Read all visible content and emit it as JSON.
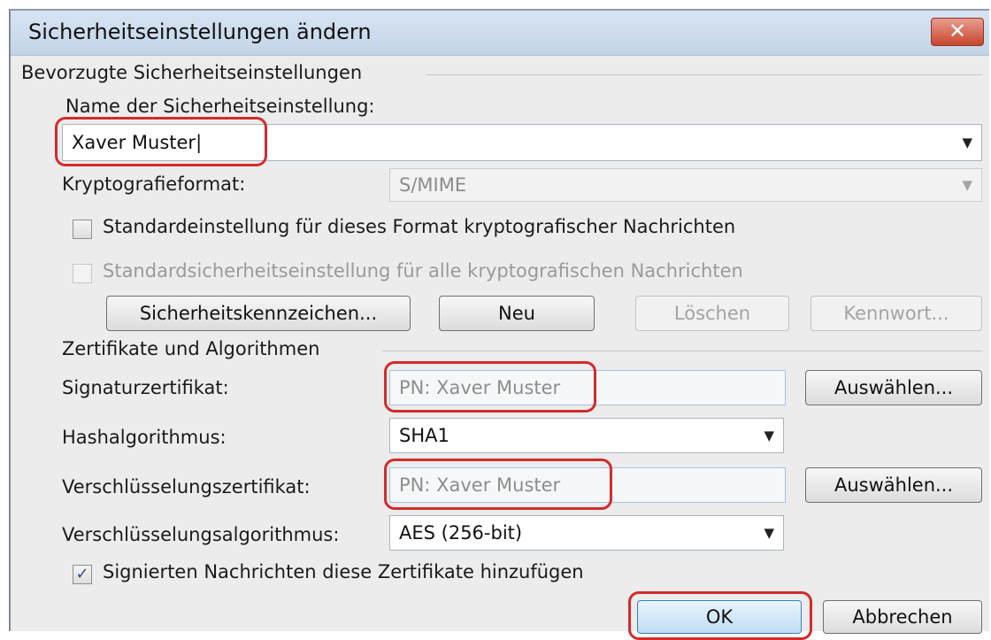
{
  "window": {
    "title": "Sicherheitseinstellungen ändern",
    "close_symbol": "✕"
  },
  "preferred": {
    "group_label": "Bevorzugte Sicherheitseinstellungen",
    "name_label": "Name der Sicherheitseinstellung:",
    "name_value": "Xaver Muster|",
    "crypto_label": "Kryptografieformat:",
    "crypto_value": "S/MIME",
    "chk_default_format_label": "Standardeinstellung für dieses Format kryptografischer Nachrichten",
    "chk_default_all_label": "Standardsicherheitseinstellung für alle kryptografischen Nachrichten",
    "btn_security_labels": "Sicherheitskennzeichen...",
    "btn_new": "Neu",
    "btn_delete": "Löschen",
    "btn_password": "Kennwort..."
  },
  "certs": {
    "group_label": "Zertifikate und Algorithmen",
    "sig_label": "Signaturzertifikat:",
    "sig_value": "PN: Xaver Muster",
    "hash_label": "Hashalgorithmus:",
    "hash_value": "SHA1",
    "enc_label": "Verschlüsselungszertifikat:",
    "enc_value": "PN: Xaver Muster",
    "encalg_label": "Verschlüsselungsalgorithmus:",
    "encalg_value": "AES (256-bit)",
    "choose_label": "Auswählen...",
    "chk_add_certs_label": "Signierten Nachrichten diese Zertifikate hinzufügen",
    "chk_add_certs_mark": "✓"
  },
  "footer": {
    "ok": "OK",
    "cancel": "Abbrechen"
  },
  "dropdown_arrow": "▼",
  "colors": {
    "highlight": "#d22b2b",
    "titlebar": "#c4d4e8",
    "dialog_bg": "#ececec"
  }
}
